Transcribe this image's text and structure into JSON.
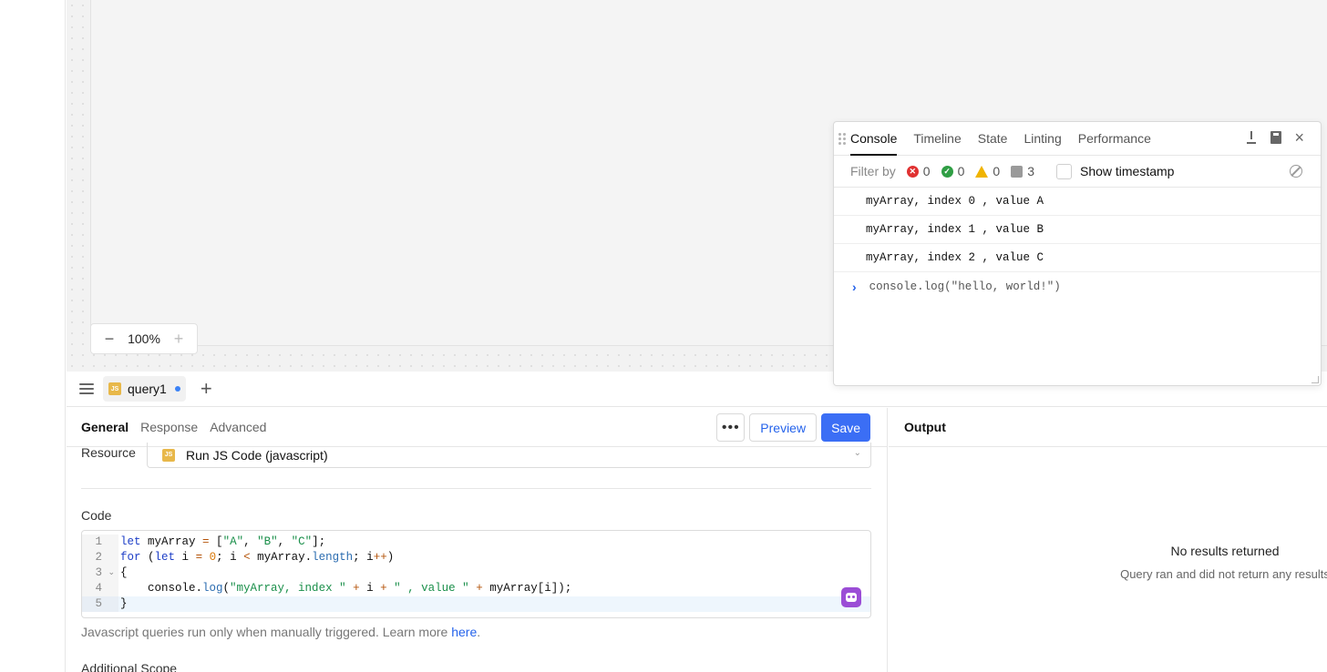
{
  "canvas": {
    "zoom_out": "−",
    "zoom_value": "100%",
    "zoom_in": "+"
  },
  "query_bar": {
    "tab_badge": "JS",
    "tab_name": "query1",
    "add_tab": "+"
  },
  "editor": {
    "tabs": [
      "General",
      "Response",
      "Advanced"
    ],
    "more_label": "•••",
    "preview_label": "Preview",
    "save_label": "Save",
    "resource_label": "Resource",
    "resource_badge": "JS",
    "resource_value": "Run JS Code (javascript)",
    "code_label": "Code",
    "line_numbers": [
      "1",
      "2",
      "3",
      "4",
      "5"
    ],
    "hint_text": "Javascript queries run only when manually triggered. Learn more ",
    "hint_link": "here",
    "hint_end": ".",
    "additional_label": "Additional Scope"
  },
  "output": {
    "title": "Output",
    "empty_title": "No results returned",
    "empty_sub": "Query ran and did not return any results"
  },
  "console": {
    "tabs": [
      "Console",
      "Timeline",
      "State",
      "Linting",
      "Performance"
    ],
    "filter_label": "Filter by",
    "counts": {
      "errors": "0",
      "success": "0",
      "warnings": "0",
      "messages": "3"
    },
    "timestamp_label": "Show timestamp",
    "logs": [
      "myArray, index 0 , value A",
      "myArray, index 1 , value B",
      "myArray, index 2 , value C"
    ],
    "prompt_caret": "›",
    "prompt_text": "console.log(\"hello, world!\")"
  },
  "colors": {
    "accent": "#3b6ef5",
    "link": "#2563eb",
    "error": "#e03131",
    "success": "#2f9e44",
    "warning": "#f0b400",
    "assist": "#9b4dd6"
  }
}
